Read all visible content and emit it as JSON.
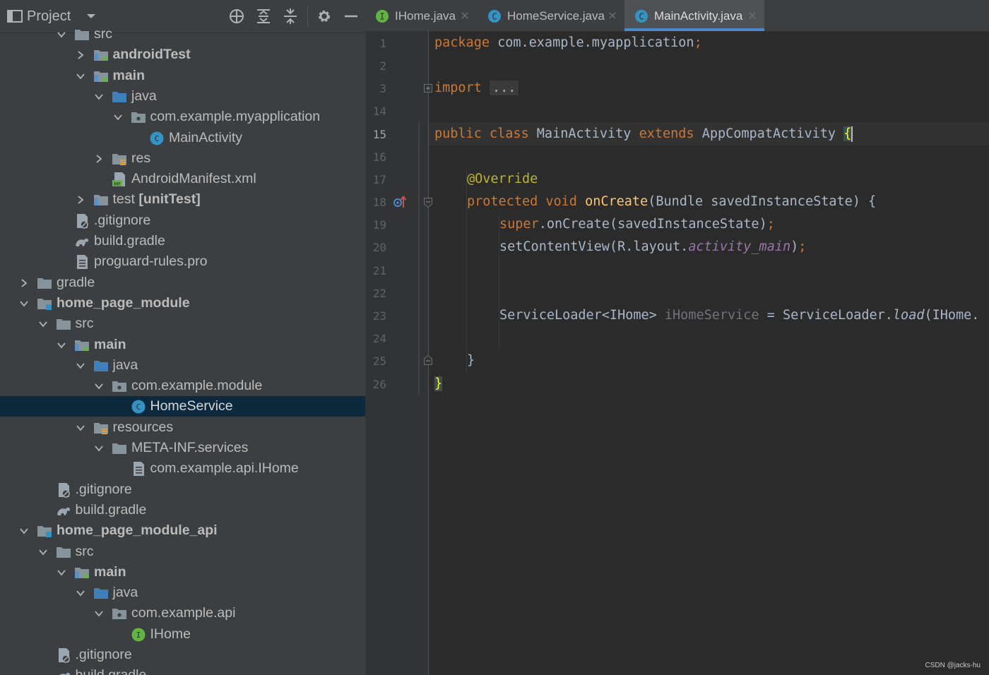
{
  "colors": {
    "panel_bg": "#3c3f41",
    "editor_bg": "#2b2b2b",
    "selection": "#0d293e",
    "keyword": "#cc7832",
    "annotation": "#bbb529",
    "method": "#ffc66d",
    "field": "#9876aa",
    "accent": "#4a88c7"
  },
  "project_panel": {
    "title": "Project",
    "toolbar": [
      "locate-icon",
      "expand-all-icon",
      "collapse-all-icon",
      "gear-icon",
      "minimize-icon"
    ]
  },
  "tree": [
    {
      "label": "src",
      "depth": 2,
      "expanded": true,
      "icon": "folder-icon"
    },
    {
      "label": "androidTest",
      "depth": 3,
      "expanded": false,
      "icon": "source-folder-icon",
      "bold": true
    },
    {
      "label": "main",
      "depth": 3,
      "expanded": true,
      "icon": "source-folder-icon",
      "bold": true
    },
    {
      "label": "java",
      "depth": 4,
      "expanded": true,
      "icon": "blue-folder-icon"
    },
    {
      "label": "com.example.myapplication",
      "depth": 5,
      "expanded": true,
      "icon": "package-icon"
    },
    {
      "label": "MainActivity",
      "depth": 6,
      "icon": "class-icon"
    },
    {
      "label": "res",
      "depth": 4,
      "expanded": false,
      "icon": "resource-folder-icon"
    },
    {
      "label": "AndroidManifest.xml",
      "depth": 4,
      "icon": "manifest-icon"
    },
    {
      "label": "test",
      "suffix": " [unitTest]",
      "depth": 3,
      "expanded": false,
      "icon": "test-folder-icon"
    },
    {
      "label": ".gitignore",
      "depth": 2,
      "icon": "gitignore-icon"
    },
    {
      "label": "build.gradle",
      "depth": 2,
      "icon": "gradle-icon"
    },
    {
      "label": "proguard-rules.pro",
      "depth": 2,
      "icon": "text-file-icon"
    },
    {
      "label": "gradle",
      "depth": 0,
      "expanded": false,
      "icon": "folder-icon"
    },
    {
      "label": "home_page_module",
      "depth": 0,
      "expanded": true,
      "icon": "module-icon",
      "bold": true
    },
    {
      "label": "src",
      "depth": 1,
      "expanded": true,
      "icon": "folder-icon"
    },
    {
      "label": "main",
      "depth": 2,
      "expanded": true,
      "icon": "source-folder-icon",
      "bold": true
    },
    {
      "label": "java",
      "depth": 3,
      "expanded": true,
      "icon": "blue-folder-icon"
    },
    {
      "label": "com.example.module",
      "depth": 4,
      "expanded": true,
      "icon": "package-icon"
    },
    {
      "label": "HomeService",
      "depth": 5,
      "icon": "class-icon",
      "selected": true
    },
    {
      "label": "resources",
      "depth": 3,
      "expanded": true,
      "icon": "resource-folder-icon"
    },
    {
      "label": "META-INF.services",
      "depth": 4,
      "expanded": true,
      "icon": "folder-icon"
    },
    {
      "label": "com.example.api.IHome",
      "depth": 5,
      "icon": "text-file-icon"
    },
    {
      "label": ".gitignore",
      "depth": 1,
      "icon": "gitignore-icon"
    },
    {
      "label": "build.gradle",
      "depth": 1,
      "icon": "gradle-icon"
    },
    {
      "label": "home_page_module_api",
      "depth": 0,
      "expanded": true,
      "icon": "module-icon",
      "bold": true
    },
    {
      "label": "src",
      "depth": 1,
      "expanded": true,
      "icon": "folder-icon"
    },
    {
      "label": "main",
      "depth": 2,
      "expanded": true,
      "icon": "source-folder-icon",
      "bold": true
    },
    {
      "label": "java",
      "depth": 3,
      "expanded": true,
      "icon": "blue-folder-icon"
    },
    {
      "label": "com.example.api",
      "depth": 4,
      "expanded": true,
      "icon": "package-icon"
    },
    {
      "label": "IHome",
      "depth": 5,
      "icon": "interface-icon"
    },
    {
      "label": ".gitignore",
      "depth": 1,
      "icon": "gitignore-icon"
    },
    {
      "label": "build.gradle",
      "depth": 1,
      "icon": "gradle-icon"
    }
  ],
  "tabs": [
    {
      "label": "IHome.java",
      "icon": "interface-icon",
      "icon_letter": "I",
      "active": false
    },
    {
      "label": "HomeService.java",
      "icon": "class-icon",
      "icon_letter": "C",
      "active": false
    },
    {
      "label": "MainActivity.java",
      "icon": "class-icon",
      "icon_letter": "C",
      "active": true
    }
  ],
  "editor": {
    "line_numbers": [
      "1",
      "2",
      "3",
      "14",
      "15",
      "16",
      "17",
      "18",
      "19",
      "20",
      "21",
      "22",
      "23",
      "24",
      "25",
      "26"
    ],
    "current_line": "15",
    "code": {
      "l1": {
        "kw": "package",
        "rest": " com.example.myapplication",
        "semi": ";"
      },
      "l3": {
        "kw": "import",
        "fold": "..."
      },
      "l15": {
        "kw1": "public class",
        "name": " MainActivity ",
        "kw2": "extends",
        "super": " AppCompatActivity ",
        "brace": "{"
      },
      "l17": {
        "ann": "@Override"
      },
      "l18": {
        "kw": "protected void",
        "fn": "onCreate",
        "params": "(Bundle savedInstanceState) {"
      },
      "l19": {
        "kw": "super",
        "call": ".onCreate(savedInstanceState)",
        "semi": ";"
      },
      "l20": {
        "call": "setContentView(R.layout.",
        "fld": "activity_main",
        "close": ")",
        "semi": ";"
      },
      "l23": {
        "type": "ServiceLoader<IHome> ",
        "var": "iHomeService",
        "eq": " = ServiceLoader.",
        "method": "load",
        "args": "(IHome."
      },
      "l25": {
        "close": "}"
      },
      "l26": {
        "close": "}"
      }
    }
  },
  "watermark": "CSDN @jacks-hu"
}
